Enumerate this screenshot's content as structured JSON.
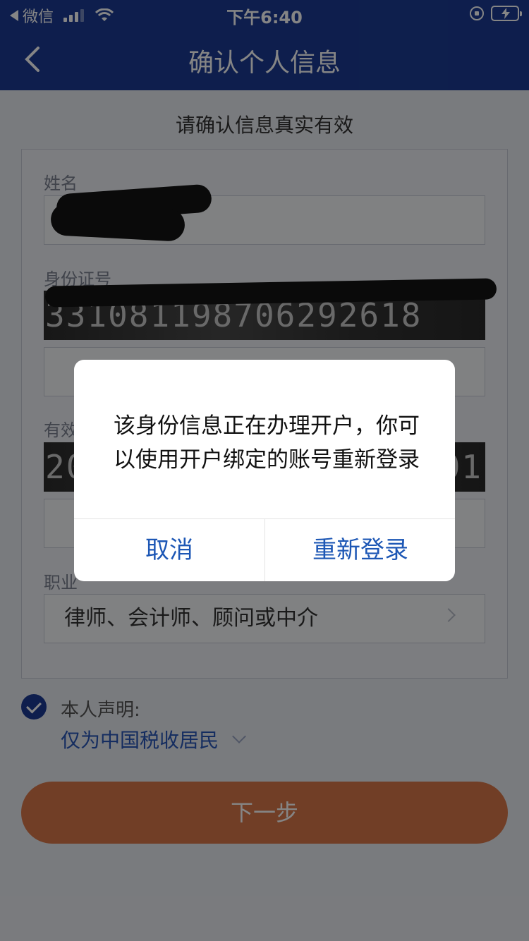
{
  "status_bar": {
    "back_app": "微信",
    "time": "下午6:40"
  },
  "nav": {
    "title": "确认个人信息"
  },
  "form": {
    "subtitle": "请确认信息真实有效",
    "name_label": "姓名",
    "id_label": "身份证号",
    "id_photo_text": "331081198706292618",
    "validity_label": "有效",
    "validity_photo_left": "20",
    "validity_photo_right": "01",
    "occupation_label": "职业",
    "occupation_value": "律师、会计师、顾问或中介"
  },
  "declaration": {
    "label": "本人声明:",
    "value": "仅为中国税收居民"
  },
  "next_button": "下一步",
  "dialog": {
    "message": "该身份信息正在办理开户，你可以使用开户绑定的账号重新登录",
    "cancel": "取消",
    "relogin": "重新登录"
  },
  "colors": {
    "brand_blue": "#1b3b94",
    "button_orange": "#d8784a",
    "link_blue": "#1d57b5"
  }
}
